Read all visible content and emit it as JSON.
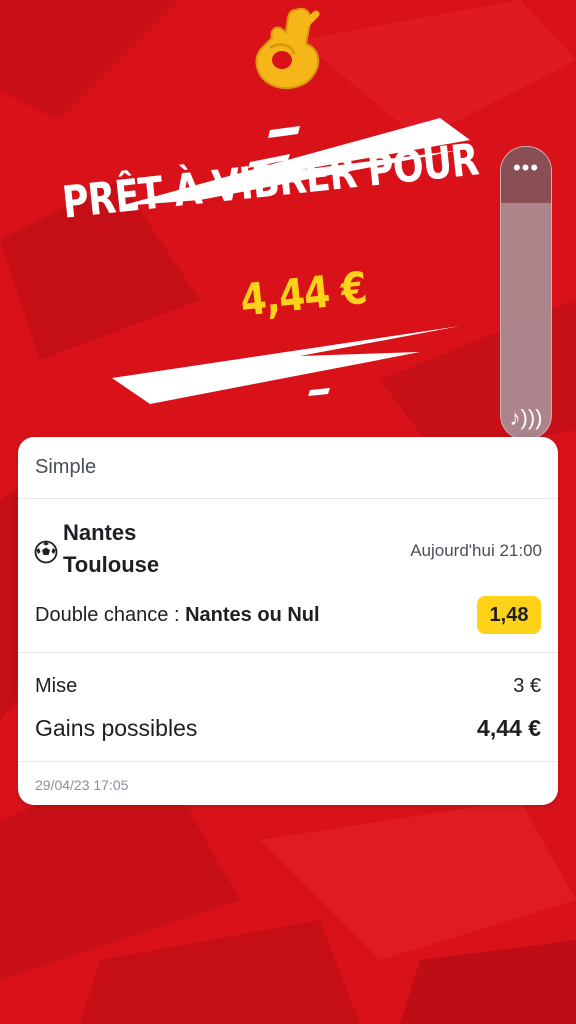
{
  "hero": {
    "title": "PRÊT À VIBRER POUR",
    "amount": "4,44 €"
  },
  "side_widget": {
    "menu_icon": "more-dots-icon",
    "sound_icon": "music-note-sound-icon"
  },
  "bet": {
    "type": "Simple",
    "team_home": "Nantes",
    "team_away": "Toulouse",
    "sport_icon": "soccer-ball-icon",
    "datetime": "Aujourd'hui 21:00",
    "market_label": "Double chance : ",
    "market_selection": "Nantes ou Nul",
    "odd": "1,48",
    "stake_label": "Mise",
    "stake_value": "3 €",
    "gains_label": "Gains possibles",
    "gains_value": "4,44 €",
    "placed_at": "29/04/23 17:05"
  },
  "colors": {
    "background": "#d9121a",
    "accent_yellow": "#ffd21a",
    "card": "#ffffff"
  }
}
